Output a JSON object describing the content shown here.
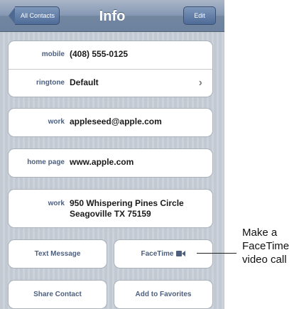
{
  "navbar": {
    "title": "Info",
    "back_label": "All Contacts",
    "edit_label": "Edit"
  },
  "phone_group": [
    {
      "label": "mobile",
      "value": "(408) 555-0125"
    },
    {
      "label": "ringtone",
      "value": "Default"
    }
  ],
  "email": {
    "label": "work",
    "value": "appleseed@apple.com"
  },
  "homepage": {
    "label": "home page",
    "value": "www.apple.com"
  },
  "address": {
    "label": "work",
    "line1": "950 Whispering Pines Circle",
    "line2": "Seagoville TX 75159"
  },
  "buttons": {
    "text_message": "Text Message",
    "facetime": "FaceTime",
    "share_contact": "Share Contact",
    "add_to_favorites": "Add to Favorites"
  },
  "callout": {
    "line1": "Make a",
    "line2": "FaceTime",
    "line3": "video call"
  },
  "icons": {
    "back": "back-arrow-icon",
    "chevron": "chevron-right-icon",
    "camera": "video-camera-icon"
  }
}
